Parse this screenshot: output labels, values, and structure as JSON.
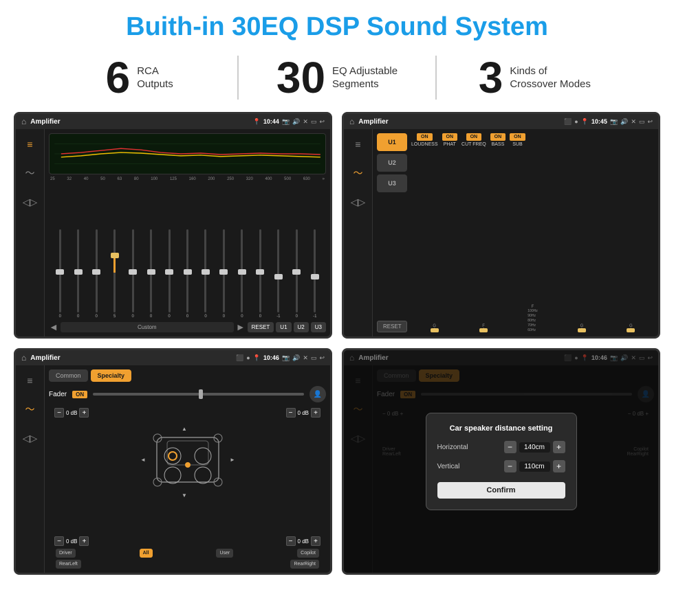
{
  "page": {
    "title": "Buith-in 30EQ DSP Sound System"
  },
  "stats": [
    {
      "number": "6",
      "line1": "RCA",
      "line2": "Outputs"
    },
    {
      "number": "30",
      "line1": "EQ Adjustable",
      "line2": "Segments"
    },
    {
      "number": "3",
      "line1": "Kinds of",
      "line2": "Crossover Modes"
    }
  ],
  "screens": {
    "eq": {
      "title": "Amplifier",
      "time": "10:44",
      "frequencies": [
        "25",
        "32",
        "40",
        "50",
        "63",
        "80",
        "100",
        "125",
        "160",
        "200",
        "250",
        "320",
        "400",
        "500",
        "630"
      ],
      "sliderValues": [
        "0",
        "0",
        "0",
        "5",
        "0",
        "0",
        "0",
        "0",
        "0",
        "0",
        "0",
        "0",
        "-1",
        "0",
        "-1"
      ],
      "sliderPositions": [
        50,
        50,
        50,
        35,
        50,
        50,
        50,
        50,
        50,
        50,
        50,
        50,
        62,
        50,
        62
      ],
      "preset": "Custom",
      "buttons": [
        "◄",
        "Custom",
        "►",
        "RESET",
        "U1",
        "U2",
        "U3"
      ]
    },
    "crossover": {
      "title": "Amplifier",
      "time": "10:45",
      "presets": [
        "U1",
        "U2",
        "U3"
      ],
      "toggles": [
        {
          "label": "LOUDNESS",
          "on": true
        },
        {
          "label": "PHAT",
          "on": true
        },
        {
          "label": "CUT FREQ",
          "on": true
        },
        {
          "label": "BASS",
          "on": true
        },
        {
          "label": "SUB",
          "on": true
        }
      ],
      "resetLabel": "RESET"
    },
    "fader": {
      "title": "Amplifier",
      "time": "10:46",
      "tabs": [
        "Common",
        "Specialty"
      ],
      "activeTab": "Specialty",
      "faderLabel": "Fader",
      "faderOn": "ON",
      "zones": {
        "front": {
          "label": "Driver",
          "db": "0 dB"
        },
        "rear": {
          "label": "Copilot",
          "db": "0 dB"
        },
        "frontLeft": {
          "label": "RearLeft",
          "db": "0 dB"
        },
        "frontRight": {
          "label": "RearRight",
          "db": "0 dB"
        },
        "all": "All",
        "user": "User"
      }
    },
    "dialog": {
      "title": "Amplifier",
      "time": "10:46",
      "tabs": [
        "Common",
        "Specialty"
      ],
      "dialogTitle": "Car speaker distance setting",
      "fields": [
        {
          "label": "Horizontal",
          "value": "140cm"
        },
        {
          "label": "Vertical",
          "value": "110cm"
        }
      ],
      "confirmLabel": "Confirm",
      "driverLabel": "Driver",
      "copilotLabel": "Copilot",
      "rearLeftLabel": "RearLeft",
      "rearRightLabel": "RearRight"
    }
  }
}
